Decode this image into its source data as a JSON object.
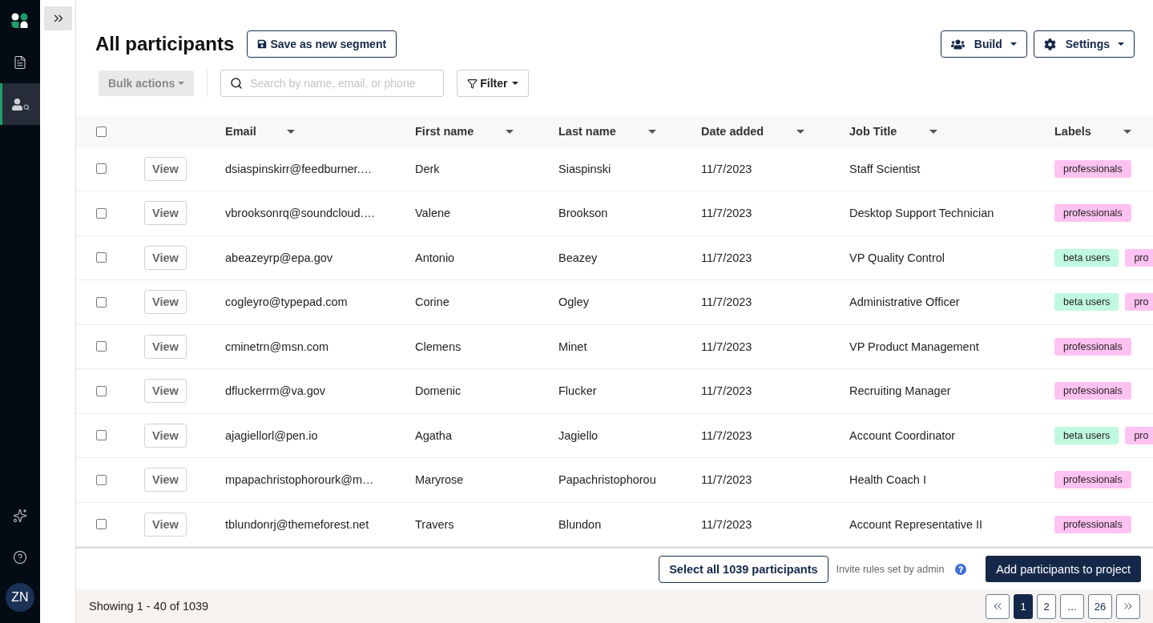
{
  "rail": {
    "items": [
      {
        "selected": false
      },
      {
        "selected": true
      }
    ],
    "avatar": "ZN"
  },
  "header": {
    "title": "All participants",
    "save_button": "Save as new segment",
    "build_button": "Build",
    "settings_button": "Settings"
  },
  "toolbar": {
    "bulk_actions": {
      "label": "Bulk actions",
      "disabled": true
    },
    "search": {
      "placeholder": "Search by name, email, or phone"
    },
    "filter": "Filter"
  },
  "table": {
    "select_all": {
      "checked": false
    },
    "columns": [
      "Email",
      "First name",
      "Last name",
      "Date added",
      "Job Title",
      "Labels"
    ],
    "rows": [
      {
        "checked": false,
        "action": "View",
        "email": "dsiaspinskirr@feedburner.…",
        "first": "Derk",
        "last": "Siaspinski",
        "date": "11/7/2023",
        "job": "Staff Scientist",
        "labels": [
          {
            "text": "professionals",
            "color": "#ffc2f1"
          }
        ]
      },
      {
        "checked": false,
        "action": "View",
        "email": "vbrooksonrq@soundcloud.…",
        "first": "Valene",
        "last": "Brookson",
        "date": "11/7/2023",
        "job": "Desktop Support Technician",
        "labels": [
          {
            "text": "professionals",
            "color": "#ffc2f1"
          }
        ]
      },
      {
        "checked": false,
        "action": "View",
        "email": "abeazeyrp@epa.gov",
        "first": "Antonio",
        "last": "Beazey",
        "date": "11/7/2023",
        "job": "VP Quality Control",
        "labels": [
          {
            "text": "beta users",
            "color": "#c0f8e0"
          },
          {
            "text": "pro",
            "color": "#ffc2f1"
          }
        ]
      },
      {
        "checked": false,
        "action": "View",
        "email": "cogleyro@typepad.com",
        "first": "Corine",
        "last": "Ogley",
        "date": "11/7/2023",
        "job": "Administrative Officer",
        "labels": [
          {
            "text": "beta users",
            "color": "#c0f8e0"
          },
          {
            "text": "pro",
            "color": "#ffc2f1"
          }
        ]
      },
      {
        "checked": false,
        "action": "View",
        "email": "cminetrn@msn.com",
        "first": "Clemens",
        "last": "Minet",
        "date": "11/7/2023",
        "job": "VP Product Management",
        "labels": [
          {
            "text": "professionals",
            "color": "#ffc2f1"
          }
        ]
      },
      {
        "checked": false,
        "action": "View",
        "email": "dfluckerrm@va.gov",
        "first": "Domenic",
        "last": "Flucker",
        "date": "11/7/2023",
        "job": "Recruiting Manager",
        "labels": [
          {
            "text": "professionals",
            "color": "#ffc2f1"
          }
        ]
      },
      {
        "checked": false,
        "action": "View",
        "email": "ajagiellorl@pen.io",
        "first": "Agatha",
        "last": "Jagiello",
        "date": "11/7/2023",
        "job": "Account Coordinator",
        "labels": [
          {
            "text": "beta users",
            "color": "#c0f8e0"
          },
          {
            "text": "pro",
            "color": "#ffc2f1"
          }
        ]
      },
      {
        "checked": false,
        "action": "View",
        "email": "mpapachristophorourk@m…",
        "first": "Maryrose",
        "last": "Papachristophorou",
        "date": "11/7/2023",
        "job": "Health Coach I",
        "labels": [
          {
            "text": "professionals",
            "color": "#ffc2f1"
          }
        ]
      },
      {
        "checked": false,
        "action": "View",
        "email": "tblundonrj@themeforest.net",
        "first": "Travers",
        "last": "Blundon",
        "date": "11/7/2023",
        "job": "Account Representative II",
        "labels": [
          {
            "text": "professionals",
            "color": "#ffc2f1"
          }
        ]
      }
    ]
  },
  "action_bar": {
    "select_all": "Select all 1039 participants",
    "note": "Invite rules set by admin",
    "add_button": "Add participants to project"
  },
  "footer": {
    "showing": "Showing 1 - 40 of 1039",
    "pages": [
      {
        "label": "1",
        "selected": true
      },
      {
        "label": "2",
        "selected": false
      },
      {
        "label": "...",
        "selected": false
      },
      {
        "label": "26",
        "selected": false
      }
    ]
  }
}
